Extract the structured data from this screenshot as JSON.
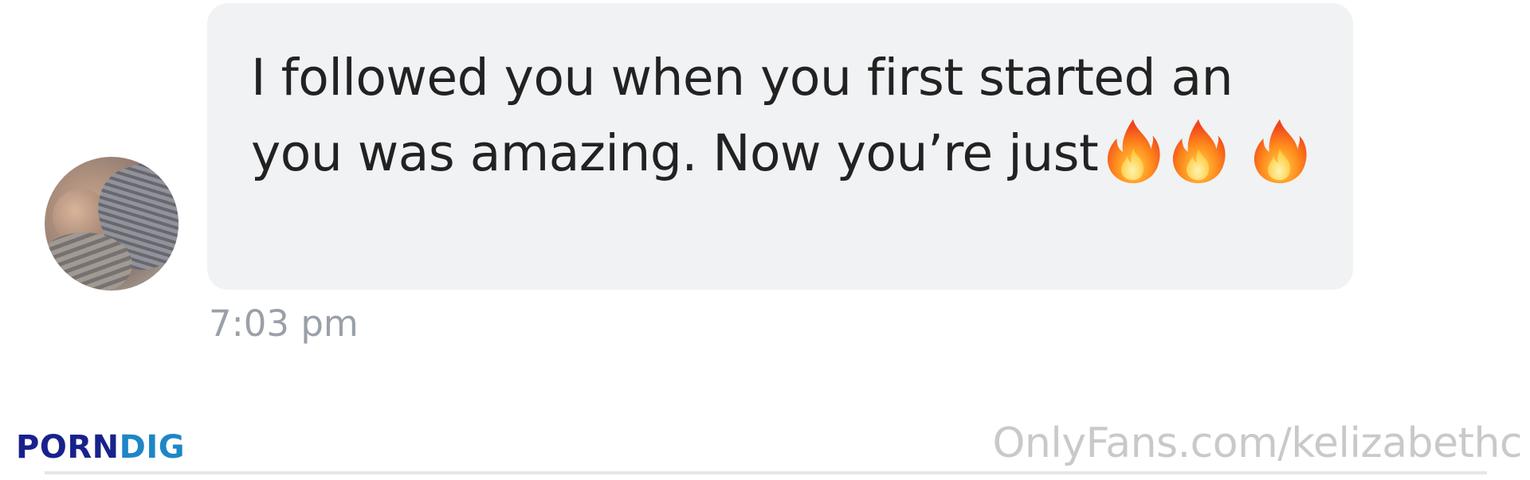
{
  "message": {
    "text": "I followed you when you first started an you was amazing. Now you’re just",
    "emoji_count": 3,
    "emoji_icon": "fire-icon",
    "timestamp": "7:03 pm"
  },
  "watermark": {
    "brand_part1": "PORN",
    "brand_part2": "DIG",
    "url": "OnlyFans.com/kelizabethc"
  },
  "colors": {
    "bubble": "#f1f2f4",
    "message_text": "#222222",
    "timestamp": "#9aa0a8",
    "brand_dark": "#18228c",
    "brand_light": "#1e86c6",
    "url": "#c9c9c9"
  }
}
